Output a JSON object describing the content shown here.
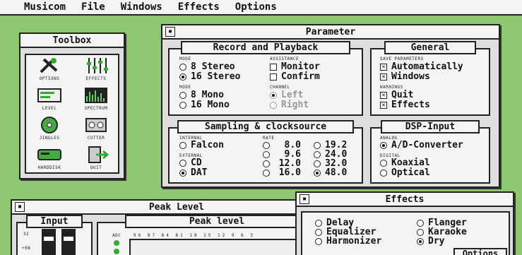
{
  "menubar": {
    "items": [
      "Musicom",
      "File",
      "Windows",
      "Effects",
      "Options"
    ]
  },
  "toolbox": {
    "title": "Toolbox",
    "tools": [
      {
        "label": "OPTIONS",
        "icon": "tools-icon"
      },
      {
        "label": "EFFECTS",
        "icon": "sliders-icon"
      },
      {
        "label": "LEVEL",
        "icon": "level-meter-icon"
      },
      {
        "label": "SPECTRUM",
        "icon": "spectrum-icon"
      },
      {
        "label": "JINGLES",
        "icon": "disc-icon"
      },
      {
        "label": "CUTTER",
        "icon": "cutter-icon"
      },
      {
        "label": "HARDDISK",
        "icon": "harddisk-icon"
      },
      {
        "label": "QUIT",
        "icon": "quit-icon"
      }
    ]
  },
  "parameter": {
    "title": "Parameter",
    "record": {
      "title": "Record and Playback",
      "mode_label": "MODE",
      "mode_options": [
        {
          "label": "8 Stereo",
          "checked": false
        },
        {
          "label": "16 Stereo",
          "checked": true
        }
      ],
      "mode2_label": "MODE",
      "mode2_options": [
        {
          "label": "8 Mono",
          "checked": false
        },
        {
          "label": "16 Mono",
          "checked": false
        }
      ],
      "assistance_label": "ASSISTANCE",
      "assistance_options": [
        {
          "label": "Monitor",
          "checked": false
        },
        {
          "label": "Confirm",
          "checked": false
        }
      ],
      "channel_label": "CHANNEL",
      "channel_options": [
        {
          "label": "Left",
          "checked": true
        },
        {
          "label": "Right",
          "checked": false
        }
      ]
    },
    "general": {
      "title": "General",
      "save_label": "SAVE PARAMETERS",
      "save_options": [
        {
          "label": "Automatically",
          "checked": true
        },
        {
          "label": "Windows",
          "checked": true
        }
      ],
      "warnings_label": "WARNINGS",
      "warning_options": [
        {
          "label": "Quit",
          "checked": true
        },
        {
          "label": "Effects",
          "checked": true
        }
      ]
    },
    "sampling": {
      "title": "Sampling & clocksource",
      "internal_label": "INTERNAL",
      "internal_options": [
        {
          "label": "Falcon",
          "checked": false
        }
      ],
      "external_label": "EXTERNAL",
      "external_options": [
        {
          "label": "CD",
          "checked": false
        },
        {
          "label": "DAT",
          "checked": true
        }
      ],
      "rate_label": "RATE",
      "rates_col1": [
        {
          "label": "8.0",
          "checked": false
        },
        {
          "label": "9.6",
          "checked": false
        },
        {
          "label": "12.0",
          "checked": false
        },
        {
          "label": "16.0",
          "checked": false
        }
      ],
      "rates_col2": [
        {
          "label": "19.2",
          "checked": false
        },
        {
          "label": "24.0",
          "checked": false
        },
        {
          "label": "32.0",
          "checked": false
        },
        {
          "label": "48.0",
          "checked": true
        }
      ]
    },
    "dsp": {
      "title": "DSP-Input",
      "analog_label": "ANALOG",
      "analog_options": [
        {
          "label": "A/D-Converter",
          "checked": true
        }
      ],
      "digital_label": "DIGITAL",
      "digital_options": [
        {
          "label": "Koaxial",
          "checked": false
        },
        {
          "label": "Optical",
          "checked": false
        }
      ]
    }
  },
  "peak": {
    "title": "Peak Level",
    "input_title": "Input",
    "scale_values": [
      "32",
      "+0B"
    ],
    "level_title": "Peak level",
    "adc_label": "ADC",
    "scale_ticks": "96 87 84 81 18 15 12 9 6 3"
  },
  "effects": {
    "title": "Effects",
    "options_col1": [
      {
        "label": "Delay",
        "checked": false
      },
      {
        "label": "Equalizer",
        "checked": false
      },
      {
        "label": "Harmonizer",
        "checked": false
      }
    ],
    "options_col2": [
      {
        "label": "Flanger",
        "checked": false
      },
      {
        "label": "Karaoke",
        "checked": false
      },
      {
        "label": "Dry",
        "checked": true
      }
    ],
    "options_button": "Options"
  }
}
